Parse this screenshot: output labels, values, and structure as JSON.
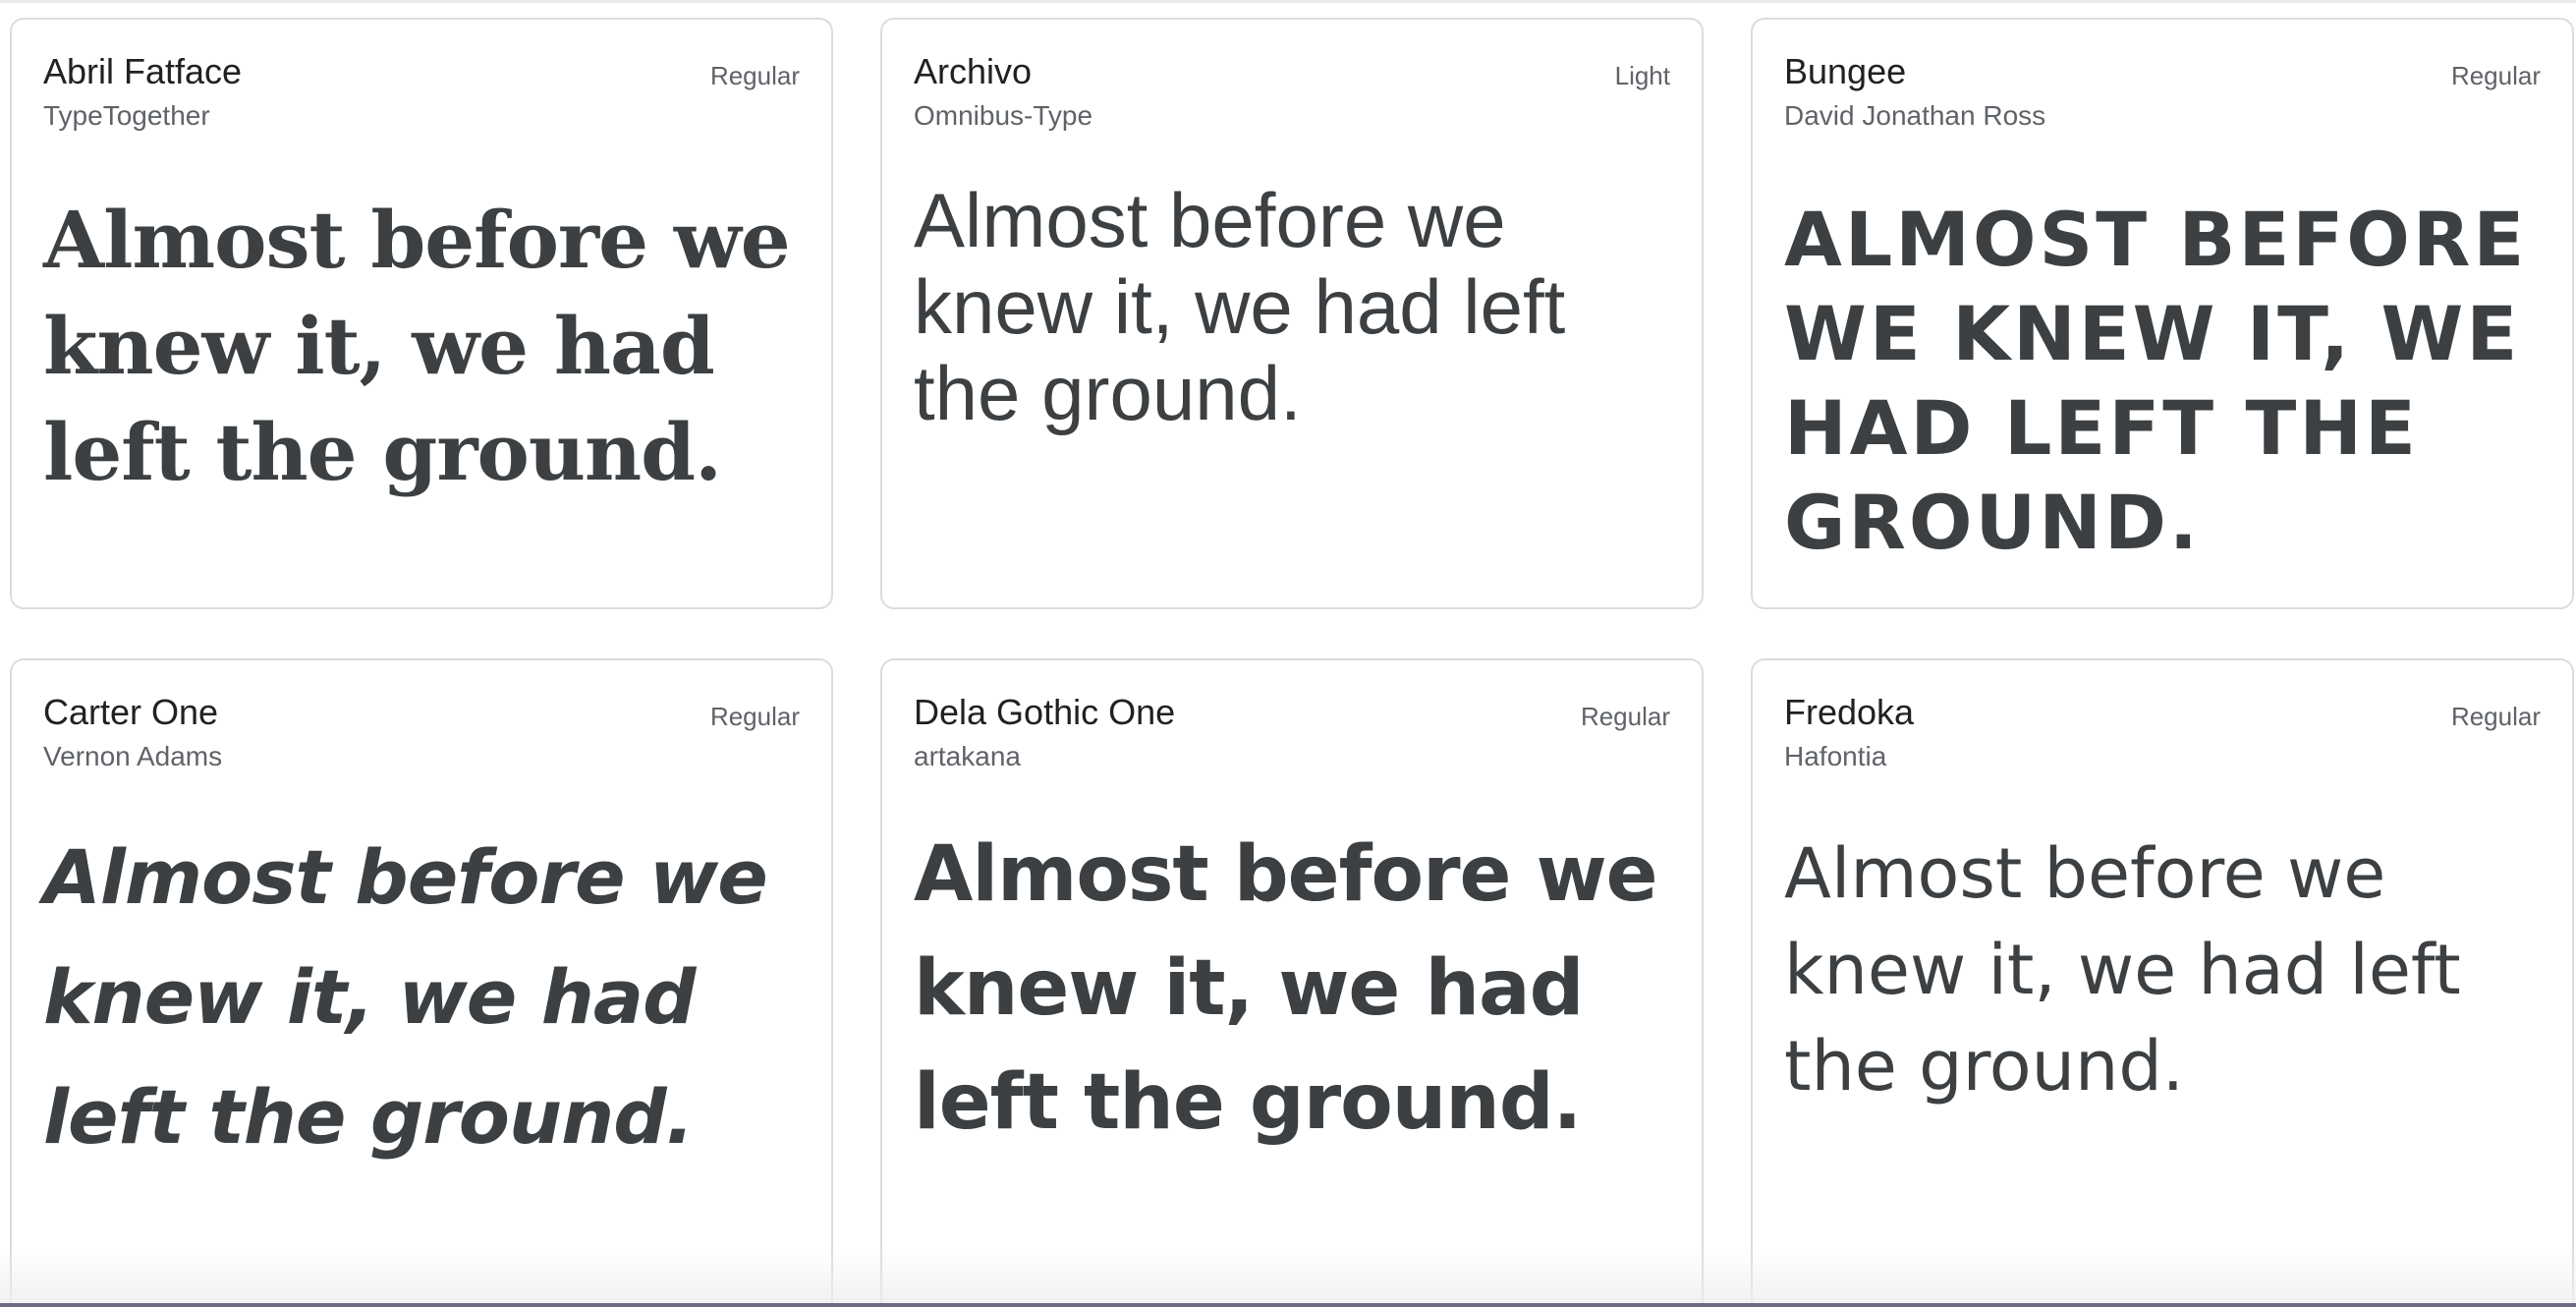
{
  "sample_text": "Almost before we knew it, we had left the ground.",
  "cards": [
    {
      "family": "Abril Fatface",
      "designer": "TypeTogether",
      "style": "Regular",
      "sample": "Almost before we knew it, we had left the ground."
    },
    {
      "family": "Archivo",
      "designer": "Omnibus-Type",
      "style": "Light",
      "sample": "Almost before we knew it, we had left the ground."
    },
    {
      "family": "Bungee",
      "designer": "David Jonathan Ross",
      "style": "Regular",
      "sample": "ALMOST BEFORE WE KNEW IT, WE HAD LEFT THE GROUND."
    },
    {
      "family": "Carter One",
      "designer": "Vernon Adams",
      "style": "Regular",
      "sample": "Almost before we knew it, we had left the ground."
    },
    {
      "family": "Dela Gothic One",
      "designer": "artakana",
      "style": "Regular",
      "sample": "Almost before we knew it, we had left the ground."
    },
    {
      "family": "Fredoka",
      "designer": "Hafontia",
      "style": "Regular",
      "sample": "Almost before we knew it, we had left the ground."
    }
  ],
  "colors": {
    "text_primary": "#202124",
    "text_secondary": "#5f6368",
    "sample_text": "#3c4043",
    "card_border": "#dadce0"
  }
}
